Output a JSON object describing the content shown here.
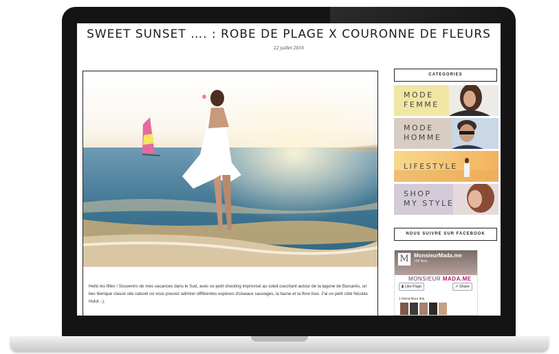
{
  "post": {
    "title": "SWEET SUNSET …. : ROBE DE PLAGE X COURONNE DE FLEURS",
    "date": "22 juillet 2016",
    "excerpt": "Hello les filles ! Souvenirs de mes vacances dans le Sud, avec ce petit shooting improvisé au soleil couchant autour de la lagune de Barcarès, un lieu féerique classé site naturel où vous pouvez admirer différentes espèces d'oiseaux sauvages, la faune et la flore lisui. J'ai un petit côté Nicolas Hulot ..)."
  },
  "sidebar": {
    "categories_title": "CATEGORIES",
    "categories": [
      {
        "line1": "MODE",
        "line2": "FEMME",
        "tint": "#efe39a"
      },
      {
        "line1": "MODE",
        "line2": "HOMME",
        "tint": "#d8ccc4"
      },
      {
        "line1": "LIFESTYLE",
        "line2": "",
        "tint": "#f4c26c"
      },
      {
        "line1": "SHOP",
        "line2": "MY STYLE",
        "tint": "#cfc6d6"
      }
    ],
    "facebook_title": "NOUS SUIVRE SUR FACEBOOK",
    "facebook": {
      "page_name": "MonsieurMada.me",
      "likes": "198 likes",
      "brand_a": "MONSIEUR ",
      "brand_b": "MADA.ME",
      "like_button": "Like Page",
      "share_button": "Share",
      "friends_text": "1 friend likes this"
    }
  }
}
